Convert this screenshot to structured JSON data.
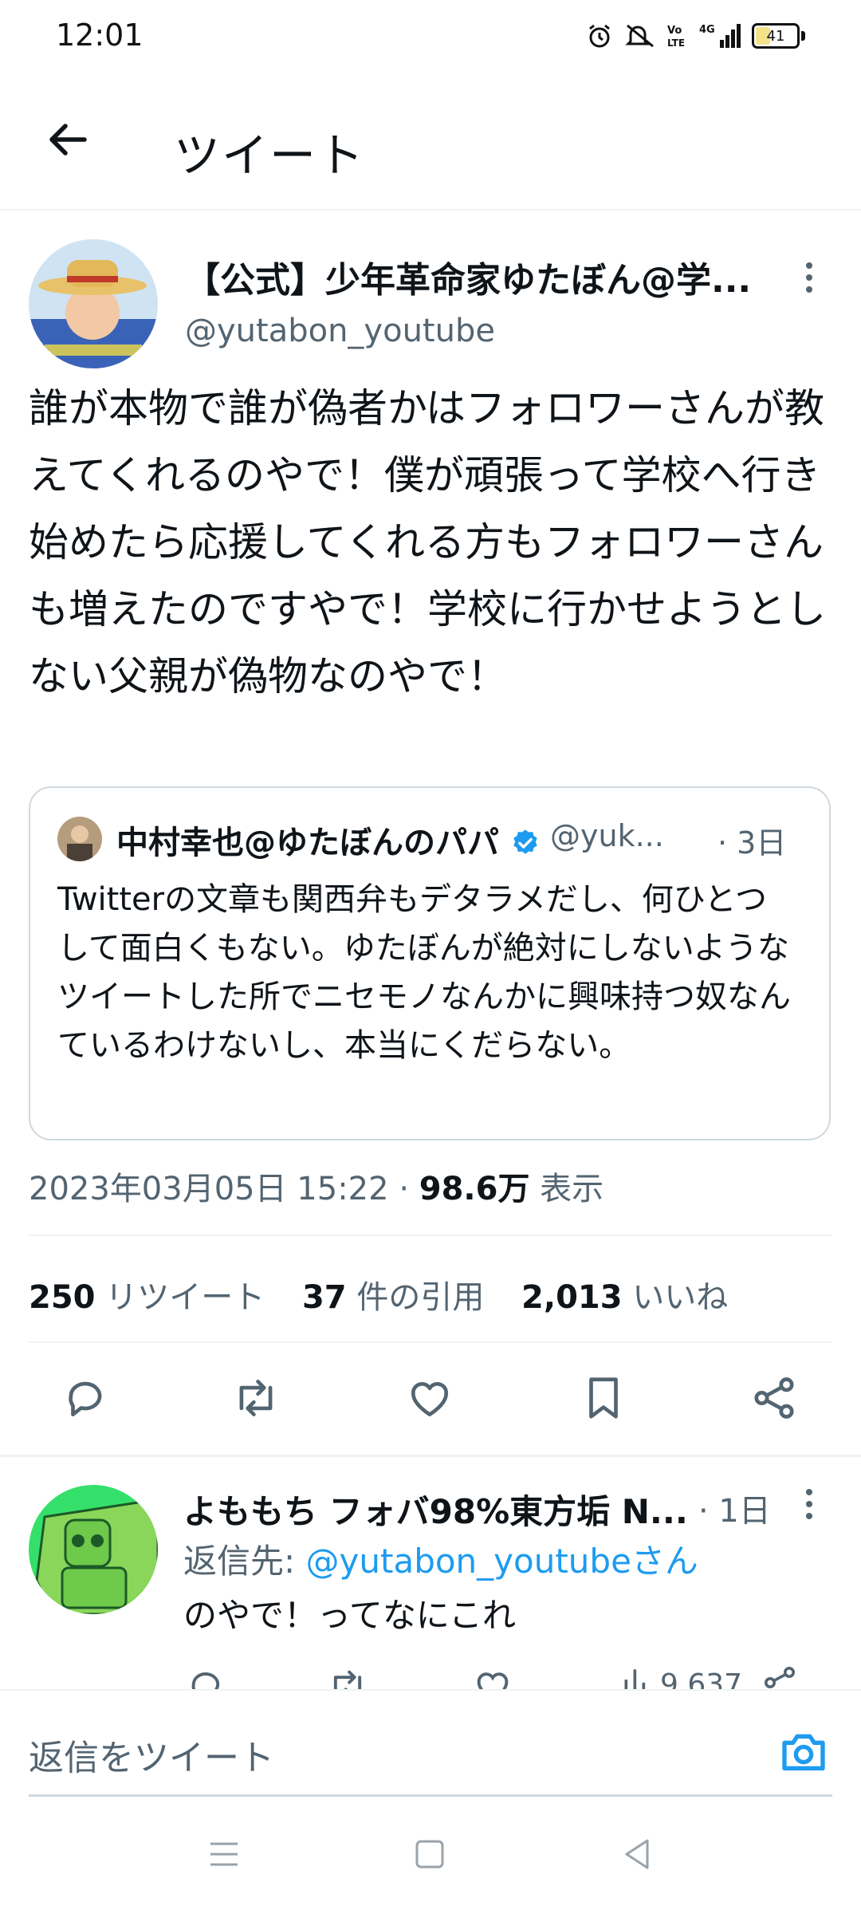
{
  "status_bar": {
    "time": "12:01",
    "network": "4G",
    "battery": "41",
    "battery_level": 0.41
  },
  "header": {
    "title": "ツイート"
  },
  "tweet": {
    "author_name": "【公式】少年革命家ゆたぼん@学...",
    "author_handle": "@yutabon_youtube",
    "text": "誰が本物で誰が偽者かはフォロワーさんが教えてくれるのやで！僕が頑張って学校へ行き始めたら応援してくれる方もフォロワーさんも増えたのですやで！学校に行かせようとしない父親が偽物なのやで！",
    "quote": {
      "author_name": "中村幸也@ゆたぼんのパパ",
      "author_handle": "@yuk...",
      "time": "· 3日",
      "text": "Twitterの文章も関西弁もデタラメだし、何ひとつして面白くもない。ゆたぼんが絶対にしないようなツイートした所でニセモノなんかに興味持つ奴なんているわけないし、本当にくだらない。"
    },
    "date": "2023年03月05日 15:22",
    "separator": "·",
    "views": "98.6万",
    "views_label": "表示",
    "retweets": "250",
    "retweets_label": "リツイート",
    "quotes": "37",
    "quotes_label": "件の引用",
    "likes": "2,013",
    "likes_label": "いいね"
  },
  "actions": [
    "reply-icon",
    "retweet-icon",
    "like-icon",
    "bookmark-icon",
    "share-icon"
  ],
  "reply": {
    "author_name": "よももち フォバ98%東方垢 N...",
    "time": "· 1日",
    "reply_to_prefix": "返信先: ",
    "reply_to_handle": "@yutabon_youtubeさん",
    "text": "のやで！ってなにこれ",
    "views": "9,637"
  },
  "compose": {
    "placeholder": "返信をツイート"
  },
  "colors": {
    "accent": "#1d9bf0",
    "secondary_text": "#536471",
    "border": "#cfd9de"
  }
}
